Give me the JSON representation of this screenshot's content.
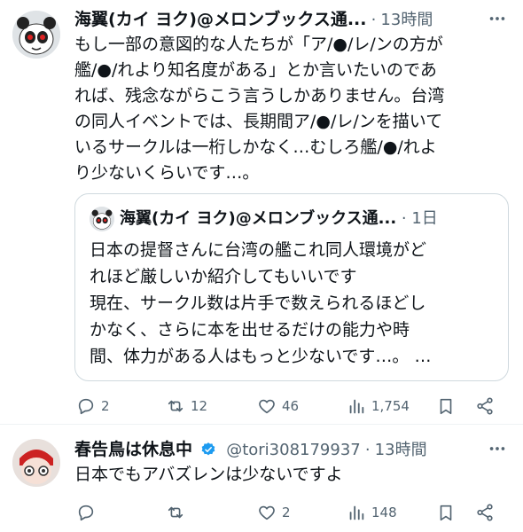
{
  "tweet1": {
    "display_name": "海翼(カイ ヨク)@メロンブックス通...",
    "separator": "·",
    "time": "13時間",
    "text_lines": [
      "もし一部の意図的な人たちが「ア/●/レ/ンの方が",
      "艦/●/れより知名度がある」とか言いたいのであ",
      "れば、残念ながらこう言うしかありません。台湾",
      "の同人イベントでは、長期間ア/●/レ/ンを描いて",
      "いるサークルは一桁しかなく…むしろ艦/●/れよ",
      "り少ないくらいです…。"
    ],
    "quote": {
      "display_name": "海翼(カイ ヨク)@メロンブックス通...",
      "separator": "·",
      "time": "1日",
      "text_lines": [
        "日本の提督さんに台湾の艦これ同人環境がど",
        "れほど厳しいか紹介してもいいです",
        "現在、サークル数は片手で数えられるほどし",
        "かなく、さらに本を出せるだけの能力や時",
        "間、体力がある人はもっと少ないです…。 …"
      ]
    },
    "actions": {
      "replies": "2",
      "reposts": "12",
      "likes": "46",
      "views": "1,754"
    }
  },
  "tweet2": {
    "display_name": "春告鳥は休息中",
    "handle": "@tori308179937",
    "separator": "·",
    "time": "13時間",
    "text": "日本でもアバズレンは少ないですよ",
    "actions": {
      "replies": "",
      "reposts": "",
      "likes": "2",
      "views": "148"
    }
  },
  "colors": {
    "text": "#0f1419",
    "secondary": "#536471",
    "border": "#cfd9de",
    "verified": "#1d9bf0"
  }
}
